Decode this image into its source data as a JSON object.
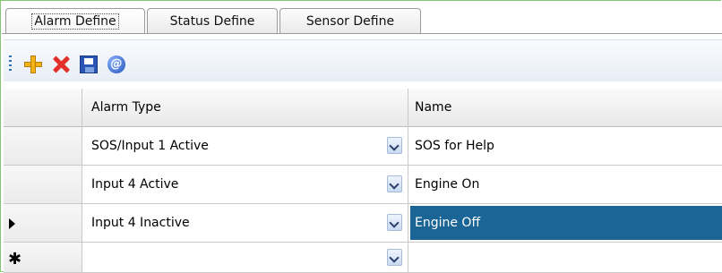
{
  "tabs": [
    {
      "label": "Alarm Define",
      "active": true
    },
    {
      "label": "Status Define",
      "active": false
    },
    {
      "label": "Sensor Define",
      "active": false
    }
  ],
  "toolbar": {
    "buttons": [
      {
        "icon": "add-icon"
      },
      {
        "icon": "delete-icon"
      },
      {
        "icon": "save-icon"
      },
      {
        "icon": "info-icon",
        "glyph": "@"
      }
    ]
  },
  "grid": {
    "columns": [
      "Alarm Type",
      "Name"
    ],
    "rows": [
      {
        "alarm_type": "SOS/Input 1 Active",
        "name": "SOS for Help"
      },
      {
        "alarm_type": "Input 4 Active",
        "name": "Engine On"
      },
      {
        "alarm_type": "Input 4 Inactive",
        "name": "Engine Off",
        "current": true,
        "name_selected": true
      }
    ],
    "new_row_marker": "✱"
  },
  "colors": {
    "selection": "#1a6496",
    "frame": "#88c478"
  }
}
